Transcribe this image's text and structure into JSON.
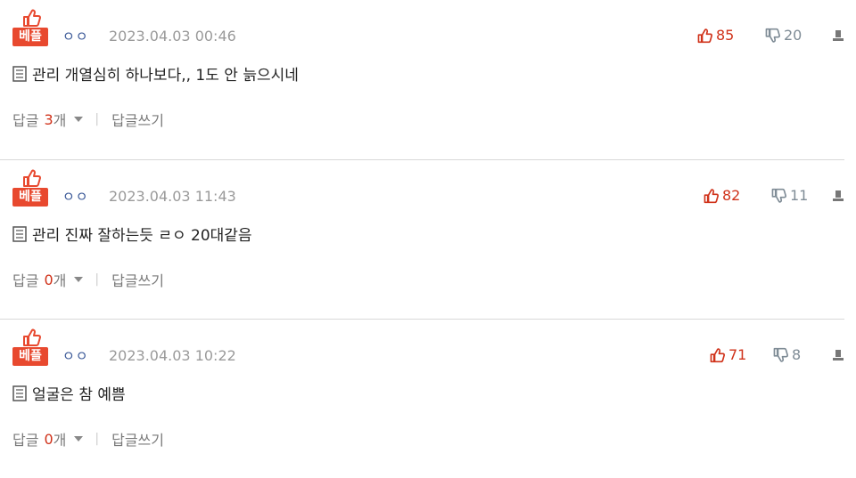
{
  "comments": [
    {
      "badge": "베플",
      "nickname": "ㅇㅇ",
      "date": "2023.04.03 00:46",
      "likes": "85",
      "dislikes": "20",
      "text": "관리 개열심히 하나보다,, 1도 안 늙으시네",
      "reply_label": "답글",
      "reply_count": "3",
      "reply_unit": "개",
      "write_reply": "답글쓰기"
    },
    {
      "badge": "베플",
      "nickname": "ㅇㅇ",
      "date": "2023.04.03 11:43",
      "likes": "82",
      "dislikes": "11",
      "text": "관리 진짜 잘하는듯 ㄹㅇ 20대같음",
      "reply_label": "답글",
      "reply_count": "0",
      "reply_unit": "개",
      "write_reply": "답글쓰기"
    },
    {
      "badge": "베플",
      "nickname": "ㅇㅇ",
      "date": "2023.04.03 10:22",
      "likes": "71",
      "dislikes": "8",
      "text": "얼굴은 참 예쁨",
      "reply_label": "답글",
      "reply_count": "0",
      "reply_unit": "개",
      "write_reply": "답글쓰기"
    }
  ],
  "colors": {
    "badge": "#e8492f",
    "like": "#d0321a",
    "dislike": "#7f8c96",
    "muted": "#9a9a9a"
  },
  "icons": {
    "badge_thumb": "thumbs-up-icon",
    "like": "thumbs-up-icon",
    "dislike": "thumbs-down-icon",
    "report": "report-icon",
    "memo": "memo-icon",
    "expand": "chevron-down-icon"
  }
}
